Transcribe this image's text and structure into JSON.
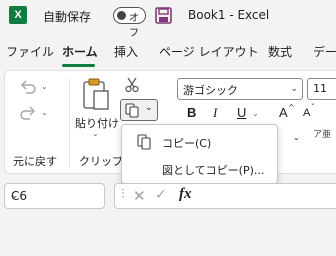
{
  "titlebar": {
    "app_icon_letter": "X",
    "autosave_label": "自動保存",
    "autosave_state": "オフ",
    "document_title": "Book1  -  Excel"
  },
  "tabs": [
    {
      "label": "ファイル"
    },
    {
      "label": "ホーム"
    },
    {
      "label": "挿入"
    },
    {
      "label": "ページ レイアウト"
    },
    {
      "label": "数式"
    },
    {
      "label": "デー"
    }
  ],
  "ribbon": {
    "undo_group_label": "元に戻す",
    "clipboard_group_label": "クリップボー",
    "paste_label": "貼り付け",
    "font_name": "游ゴシック",
    "font_size": "11",
    "bold": "B",
    "italic": "I",
    "underline": "U",
    "grow_font": "A",
    "shrink_font": "A"
  },
  "copy_menu": {
    "items": [
      {
        "label": "コピー(C)",
        "icon": "copy-icon"
      },
      {
        "label": "図としてコピー(P)...",
        "icon": "copy-as-picture-icon"
      }
    ]
  },
  "formula_bar": {
    "name_box_value": "C6",
    "fx_label": "fx"
  },
  "colors": {
    "brand_green": "#107c41",
    "save_purple": "#80397b"
  }
}
